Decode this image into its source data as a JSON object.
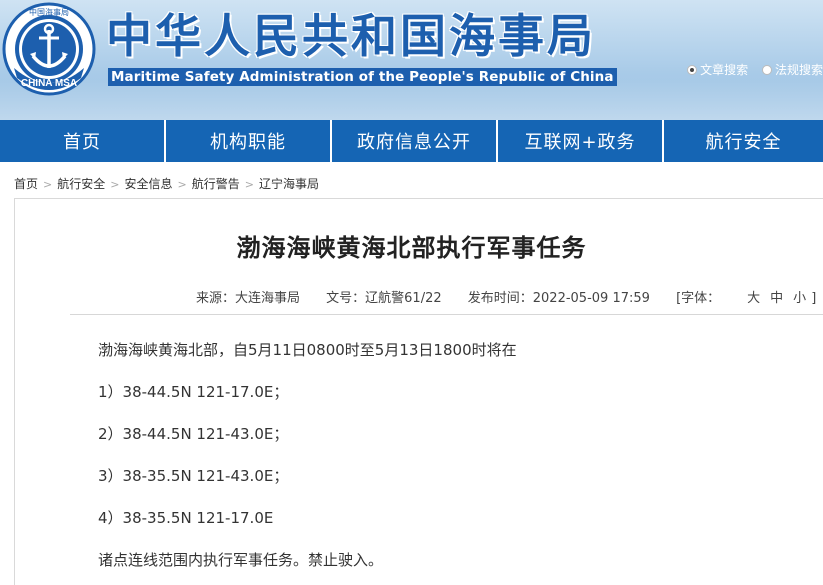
{
  "header": {
    "logo_top_text": "中国海事局",
    "logo_bottom_text": "CHINA MSA",
    "title": "中华人民共和国海事局",
    "subtitle": "Maritime Safety Administration of the People's Republic of China",
    "search_options": [
      "文章搜索",
      "法规搜索"
    ]
  },
  "nav": {
    "items": [
      "首页",
      "机构职能",
      "政府信息公开",
      "互联网+政务",
      "航行安全"
    ]
  },
  "breadcrumb": [
    "首页",
    "航行安全",
    "安全信息",
    "航行警告",
    "辽宁海事局"
  ],
  "article": {
    "title": "渤海海峡黄海北部执行军事任务",
    "meta": {
      "source": "来源：大连海事局",
      "doc_no": "文号：辽航警61/22",
      "published": "发布时间：2022-05-09 17:59",
      "font_size_label": "[字体：",
      "font_size_options": [
        "大",
        "中",
        "小"
      ],
      "font_size_end": "]"
    },
    "paragraphs": [
      "渤海海峡黄海北部，自5月11日0800时至5月13日1800时将在",
      "1）38-44.5N    121-17.0E；",
      "2）38-44.5N    121-43.0E；",
      "3）38-35.5N    121-43.0E；",
      "4）38-35.5N    121-17.0E",
      "诸点连线范围内执行军事任务。禁止驶入。"
    ]
  }
}
